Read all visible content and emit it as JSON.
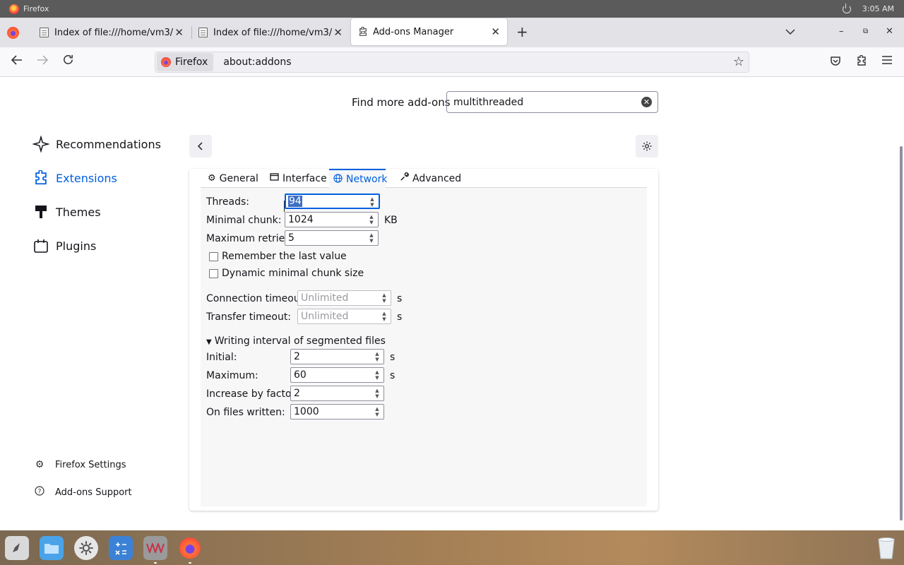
{
  "os": {
    "app_name": "Firefox",
    "clock": "3:05 AM"
  },
  "tabs": [
    {
      "label": "Index of file:///home/vm3/",
      "close": "✕"
    },
    {
      "label": "Index of file:///home/vm3/",
      "close": "✕"
    },
    {
      "label": "Add-ons Manager",
      "close": "✕"
    }
  ],
  "navbar": {
    "identity_label": "Firefox",
    "url": "about:addons"
  },
  "addons": {
    "find_label": "Find more add-ons",
    "search_value": "multithreaded",
    "categories": [
      {
        "label": "Recommendations",
        "icon": "sparkle-icon"
      },
      {
        "label": "Extensions",
        "icon": "puzzle-icon"
      },
      {
        "label": "Themes",
        "icon": "brush-icon"
      },
      {
        "label": "Plugins",
        "icon": "plugin-icon"
      }
    ],
    "footer": [
      {
        "label": "Firefox Settings",
        "icon": "gear-icon"
      },
      {
        "label": "Add-ons Support",
        "icon": "help-icon"
      }
    ]
  },
  "options": {
    "tabs": [
      {
        "label": "General",
        "icon": "gear-icon"
      },
      {
        "label": "Interface",
        "icon": "window-icon"
      },
      {
        "label": "Network",
        "icon": "globe-icon",
        "active": true
      },
      {
        "label": "Advanced",
        "icon": "wrench-icon"
      }
    ],
    "threads": {
      "label": "Threads:",
      "value": "94"
    },
    "min_chunk": {
      "label": "Minimal chunk:",
      "value": "1024",
      "unit": "KB"
    },
    "max_retries": {
      "label": "Maximum retries:",
      "value": "5"
    },
    "remember_last": {
      "label": "Remember the last value",
      "checked": false
    },
    "dynamic_chunk": {
      "label": "Dynamic minimal chunk size",
      "checked": false
    },
    "conn_timeout": {
      "label": "Connection timeout:",
      "placeholder": "Unlimited",
      "unit": "s"
    },
    "transfer_timeout": {
      "label": "Transfer timeout:",
      "placeholder": "Unlimited",
      "unit": "s"
    },
    "writing_section": {
      "label": "Writing interval of segmented files",
      "expanded": true
    },
    "initial": {
      "label": "Initial:",
      "value": "2",
      "unit": "s"
    },
    "maximum": {
      "label": "Maximum:",
      "value": "60",
      "unit": "s"
    },
    "increase": {
      "label": "Increase by factor:",
      "value": "2"
    },
    "files_written": {
      "label": "On files written:",
      "value": "1000"
    }
  },
  "colors": {
    "accent": "#0061e0",
    "selection": "#3d6ec2"
  }
}
